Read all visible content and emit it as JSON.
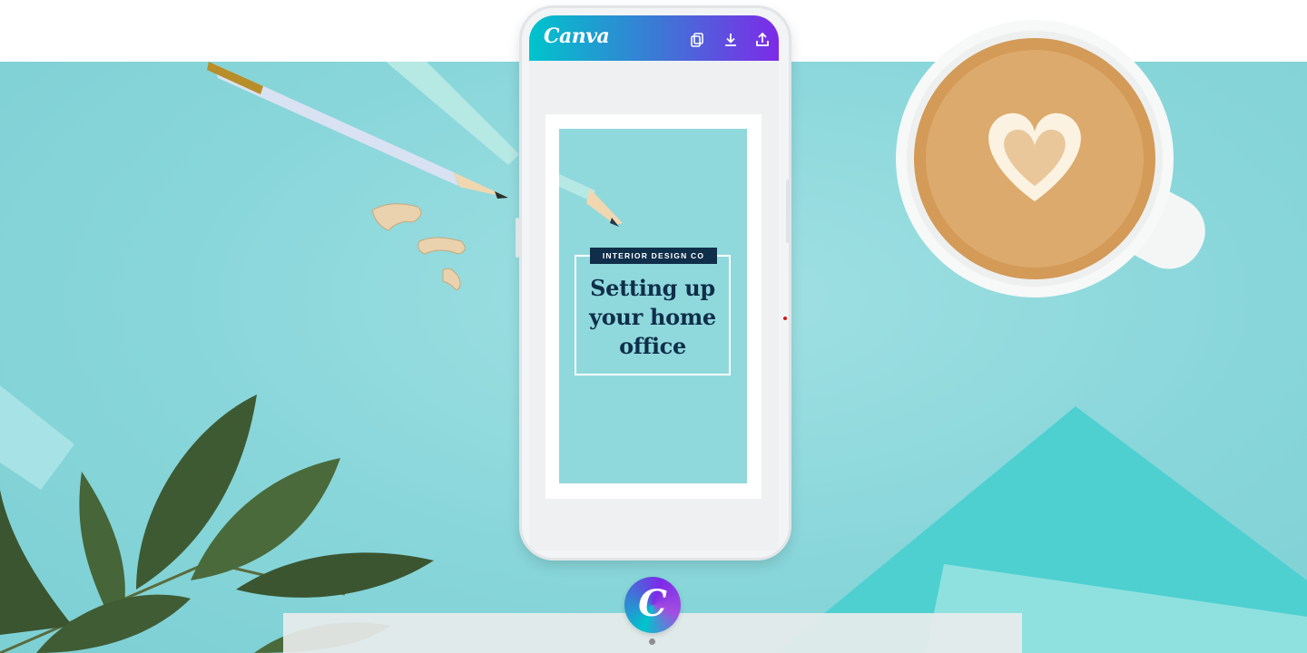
{
  "app": {
    "brand": "Canva",
    "logo_letter": "C"
  },
  "toolbar": {
    "icons": [
      "copy-icon",
      "download-icon",
      "share-icon"
    ]
  },
  "design_card": {
    "tag": "INTERIOR DESIGN CO",
    "headline_lines": [
      "Setting up",
      "your home",
      "office"
    ]
  },
  "colors": {
    "brand_gradient_start": "#00c4cc",
    "brand_gradient_mid": "#3a7bd5",
    "brand_gradient_end": "#7d2ae8",
    "background_teal": "#8bd8dc",
    "headline_navy": "#0f2e4a"
  }
}
